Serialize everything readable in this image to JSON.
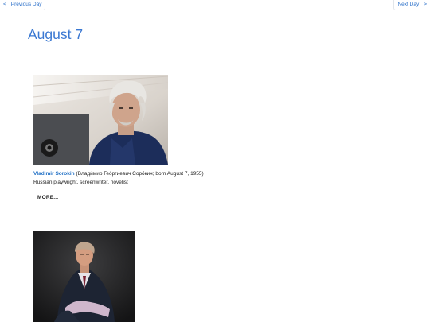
{
  "nav": {
    "prev_label": "Previous Day",
    "next_label": "Next Day",
    "prev_icon": "<",
    "next_icon": ">"
  },
  "page": {
    "title": "August 7"
  },
  "entries": [
    {
      "name": "Vladimir Sorokin",
      "detail": " (Влади́мир Гео́ргиевич Соро́кин; born August 7, 1955)",
      "description": "Russian playwright, screenwriter, novelist",
      "more_label": "MORE..."
    },
    {
      "photo_only": true
    }
  ],
  "colors": {
    "link": "#2a6fc9",
    "title": "#3a78d2",
    "name": "#1f6fc5"
  }
}
